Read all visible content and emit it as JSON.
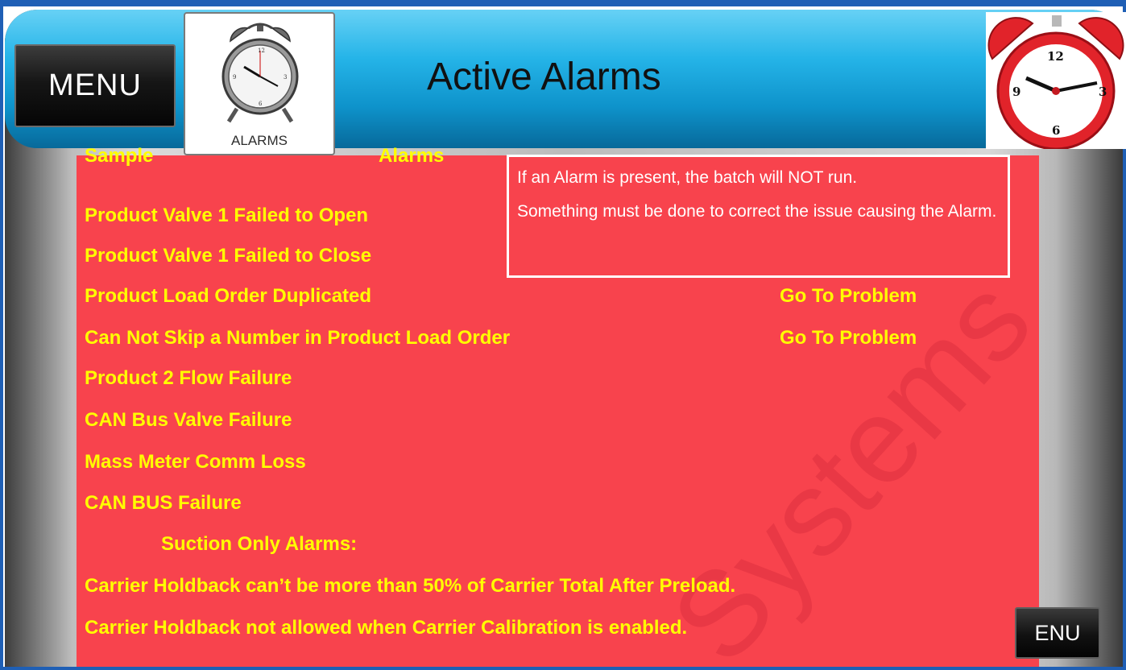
{
  "header": {
    "menu_label": "MENU",
    "alarms_button_label": "ALARMS",
    "title": "Active Alarms"
  },
  "alarm_list": {
    "header_left": "Sample",
    "header_right": "Alarms",
    "items": [
      "Product Valve 1 Failed to Open",
      "Product Valve 1 Failed to Close",
      "Product Load Order Duplicated",
      "Can Not Skip a Number in Product Load Order",
      "Product 2 Flow Failure",
      "CAN Bus Valve Failure",
      "Mass Meter Comm Loss",
      "CAN BUS Failure"
    ],
    "goto_problem_label": "Go To Problem",
    "suction_heading": "Suction Only Alarms:",
    "suction_items": [
      "Carrier Holdback can’t be more than 50% of Carrier Total After Preload.",
      "Carrier Holdback not allowed when Carrier Calibration is enabled."
    ]
  },
  "note": {
    "line1": "If an Alarm is present, the batch will NOT run.",
    "line2": "Something must be done to correct the issue causing the Alarm."
  },
  "footer": {
    "menu_label": "ENU"
  },
  "watermark": "Systems",
  "colors": {
    "panel": "#f8434d",
    "alarm_text": "#ffff00",
    "header_blue": "#25b4e8",
    "frame": "#1f5fb5"
  }
}
